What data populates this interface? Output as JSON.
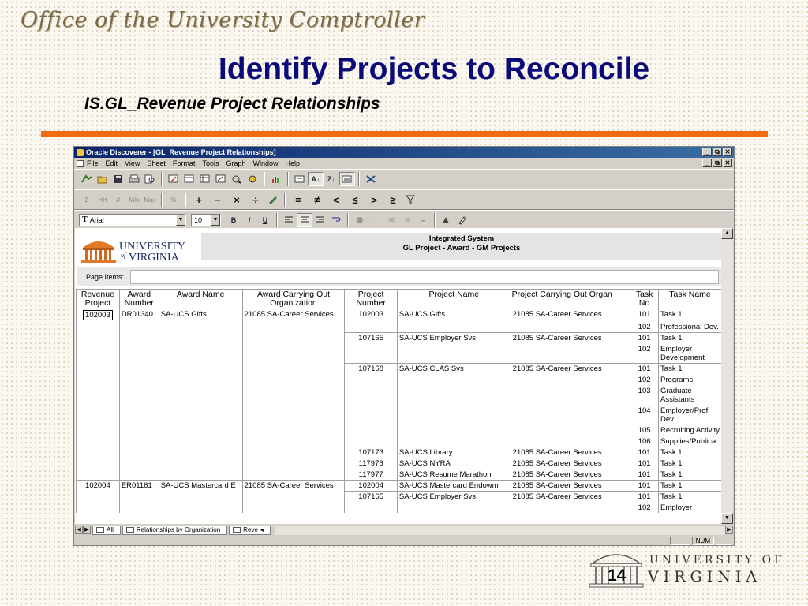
{
  "slide": {
    "office_title": "Office of the University Comptroller",
    "title": "Identify Projects to Reconcile",
    "subtitle": "IS.GL_Revenue Project Relationships",
    "page_number": "14",
    "footer_logo_line1": "UNIVERSITY OF",
    "footer_logo_line2": "VIRGINIA",
    "accent_color": "#f26b0f",
    "title_color": "#0a0a78"
  },
  "window": {
    "title": "Oracle Discoverer - [GL_Revenue Project Relationships]",
    "controls": [
      "_",
      "١",
      "x"
    ],
    "menu": [
      "File",
      "Edit",
      "View",
      "Sheet",
      "Format",
      "Tools",
      "Graph",
      "Window",
      "Help"
    ]
  },
  "toolbar": {
    "font_name": "Arial",
    "font_size": "10",
    "font_icon": "T",
    "operators": [
      "+",
      "−",
      "×",
      "÷",
      "=",
      "≠",
      "<",
      "≤",
      ">",
      "≥"
    ],
    "bold": "B",
    "italic": "i",
    "underline": "U",
    "stat_labels": [
      "Σ",
      "HH",
      "Min",
      "Max",
      "%"
    ]
  },
  "report": {
    "logo_line1": "UNIVERSITY",
    "logo_of": "of",
    "logo_line2": "VIRGINIA",
    "header_line1": "Integrated System",
    "header_line2": "GL Project - Award -  GM Projects",
    "page_items_label": "Page Items:",
    "columns": [
      "Revenue Project",
      "Award Number",
      "Award Name",
      "Award Carrying Out Organization",
      "Project Number",
      "Project Name",
      "Project Carrying Out Organ",
      "Task No",
      "Task Name"
    ],
    "rows": [
      {
        "rev": "102003",
        "award": "DR01340",
        "aname": "SA-UCS Gifts",
        "aorg": "21085 SA-Career Services",
        "proj": "102003",
        "pname": "SA-UCS Gifts",
        "porg": "21085 SA-Career Services",
        "task": "101",
        "tname": "Task 1"
      },
      {
        "rev": "",
        "award": "",
        "aname": "",
        "aorg": "",
        "proj": "",
        "pname": "",
        "porg": "",
        "task": "102",
        "tname": "Professional Dev."
      },
      {
        "rev": "",
        "award": "",
        "aname": "",
        "aorg": "",
        "proj": "107165",
        "pname": "SA-UCS Employer Svs",
        "porg": "21085 SA-Career Services",
        "task": "101",
        "tname": "Task 1"
      },
      {
        "rev": "",
        "award": "",
        "aname": "",
        "aorg": "",
        "proj": "",
        "pname": "",
        "porg": "",
        "task": "102",
        "tname": "Employer Development"
      },
      {
        "rev": "",
        "award": "",
        "aname": "",
        "aorg": "",
        "proj": "107168",
        "pname": "SA-UCS CLAS Svs",
        "porg": "21085 SA-Career Services",
        "task": "101",
        "tname": "Task 1"
      },
      {
        "rev": "",
        "award": "",
        "aname": "",
        "aorg": "",
        "proj": "",
        "pname": "",
        "porg": "",
        "task": "102",
        "tname": "Programs"
      },
      {
        "rev": "",
        "award": "",
        "aname": "",
        "aorg": "",
        "proj": "",
        "pname": "",
        "porg": "",
        "task": "103",
        "tname": "Graduate Assistants"
      },
      {
        "rev": "",
        "award": "",
        "aname": "",
        "aorg": "",
        "proj": "",
        "pname": "",
        "porg": "",
        "task": "104",
        "tname": "Employer/Prof Dev"
      },
      {
        "rev": "",
        "award": "",
        "aname": "",
        "aorg": "",
        "proj": "",
        "pname": "",
        "porg": "",
        "task": "105",
        "tname": "Recruiting Activity"
      },
      {
        "rev": "",
        "award": "",
        "aname": "",
        "aorg": "",
        "proj": "",
        "pname": "",
        "porg": "",
        "task": "106",
        "tname": "Supplies/Publica"
      },
      {
        "rev": "",
        "award": "",
        "aname": "",
        "aorg": "",
        "proj": "107173",
        "pname": "SA-UCS Library",
        "porg": "21085 SA-Career Services",
        "task": "101",
        "tname": "Task 1"
      },
      {
        "rev": "",
        "award": "",
        "aname": "",
        "aorg": "",
        "proj": "117976",
        "pname": "SA-UCS NYRA",
        "porg": "21085 SA-Career Services",
        "task": "101",
        "tname": "Task 1"
      },
      {
        "rev": "",
        "award": "",
        "aname": "",
        "aorg": "",
        "proj": "117977",
        "pname": "SA-UCS Resume Marathon",
        "porg": "21085 SA-Career Services",
        "task": "101",
        "tname": "Task 1"
      },
      {
        "rev": "102004",
        "award": "ER01161",
        "aname": "SA-UCS Mastercard E",
        "aorg": "21085 SA-Career Services",
        "proj": "102004",
        "pname": "SA-UCS Mastercard Endowm",
        "porg": "21085 SA-Career Services",
        "task": "101",
        "tname": "Task 1"
      },
      {
        "rev": "",
        "award": "",
        "aname": "",
        "aorg": "",
        "proj": "107165",
        "pname": "SA-UCS Employer Svs",
        "porg": "21085 SA-Career Services",
        "task": "101",
        "tname": "Task 1"
      },
      {
        "rev": "",
        "award": "",
        "aname": "",
        "aorg": "",
        "proj": "",
        "pname": "",
        "porg": "",
        "task": "102",
        "tname": "Employer"
      }
    ]
  },
  "sheet_tabs": [
    "All",
    "Relationships by Organization",
    "Reve"
  ],
  "status": {
    "num": "NUM"
  }
}
